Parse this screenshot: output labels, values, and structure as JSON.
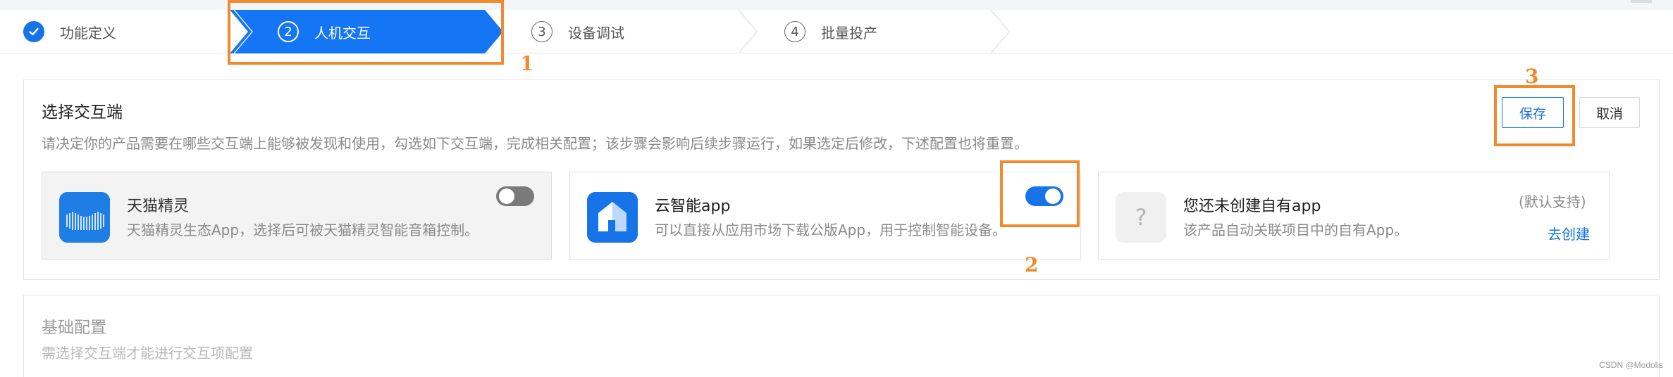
{
  "steps": [
    {
      "num": "",
      "label": "功能定义",
      "state": "done"
    },
    {
      "num": "2",
      "label": "人机交互",
      "state": "active"
    },
    {
      "num": "3",
      "label": "设备调试",
      "state": "todo"
    },
    {
      "num": "4",
      "label": "批量投产",
      "state": "todo"
    }
  ],
  "section": {
    "title": "选择交互端",
    "description": "请决定你的产品需要在哪些交互端上能够被发现和使用，勾选如下交互端，完成相关配置；该步骤会影响后续步骤运行，如果选定后修改，下述配置也将重置。"
  },
  "buttons": {
    "save": "保存",
    "cancel": "取消"
  },
  "tiles": [
    {
      "name": "天猫精灵",
      "desc": "天猫精灵生态App，选择后可被天猫精灵智能音箱控制。",
      "toggle": "off",
      "icon": "tmall-genie-icon"
    },
    {
      "name": "云智能app",
      "desc": "可以直接从应用市场下载公版App，用于控制智能设备。",
      "toggle": "on",
      "icon": "cloud-smart-app-icon"
    },
    {
      "name": "您还未创建自有app",
      "desc": "该产品自动关联项目中的自有App。",
      "aside": "(默认支持)",
      "link": "去创建",
      "icon": "question-mark-icon"
    }
  ],
  "basic": {
    "title": "基础配置",
    "desc": "需选择交互端才能进行交互项配置"
  },
  "annotations": [
    "1",
    "2",
    "3"
  ],
  "watermark": "CSDN @Modolis",
  "colors": {
    "accent": "#1674e8",
    "annotation": "#f08a2c",
    "toggle_off": "#7a7a7a"
  }
}
